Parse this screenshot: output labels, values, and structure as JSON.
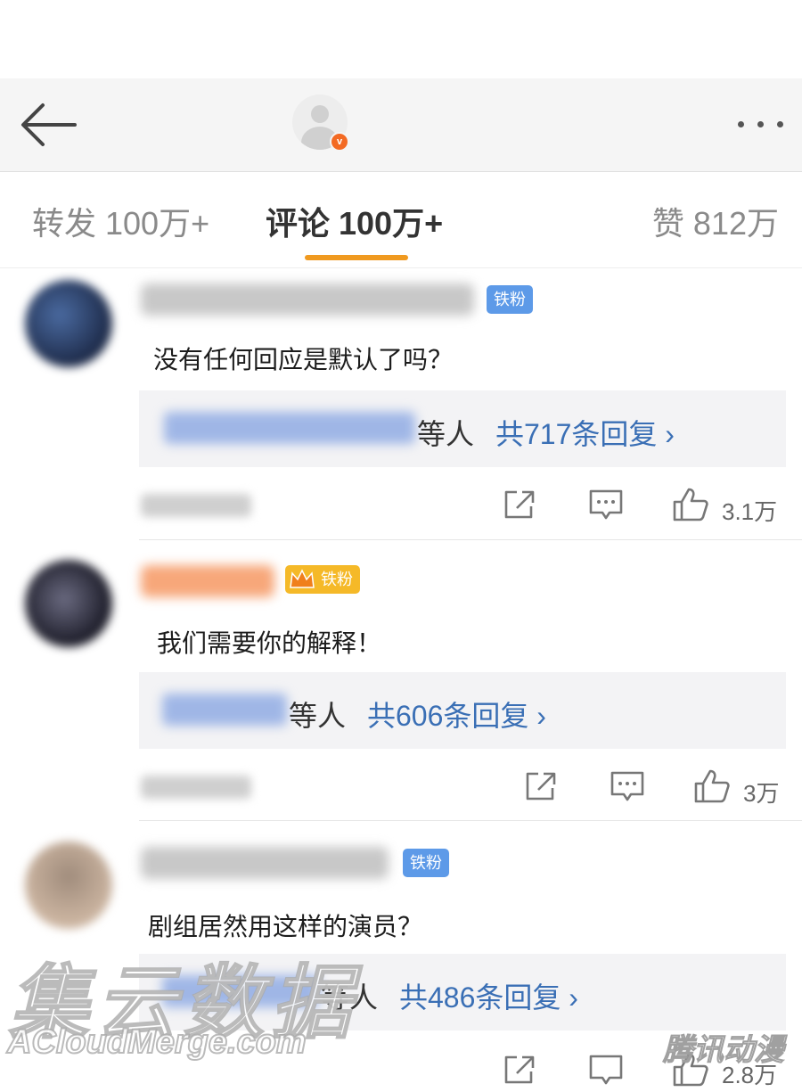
{
  "header": {
    "verified_badge": "v"
  },
  "tabs": {
    "forward": "转发 100万+",
    "comments": "评论 100万+",
    "likes": "赞 812万"
  },
  "comments": [
    {
      "fan_badge": "铁粉",
      "text": "没有任何回应是默认了吗？",
      "reply_suffix": "等人",
      "reply_count": "共717条回复 ›",
      "likes": "3.1万"
    },
    {
      "fan_badge": "铁粉",
      "text": "我们需要你的解释！",
      "reply_suffix": "等人",
      "reply_count": "共606条回复 ›",
      "likes": "3万"
    },
    {
      "fan_badge": "铁粉",
      "text": "剧组居然用这样的演员？",
      "reply_suffix": "等人",
      "reply_count": "共486条回复 ›",
      "likes": "2.8万"
    }
  ],
  "watermark": {
    "cn": "集云数据",
    "en": "ACloudMerge.com",
    "corner": "腾讯动漫"
  },
  "colors": {
    "accent_underline": "#f09a20",
    "reply_link": "#3a6fb5",
    "fan_badge_blue": "#5d9ae8",
    "fan_badge_gold": "#f5b928",
    "verified_orange": "#f36a23"
  }
}
